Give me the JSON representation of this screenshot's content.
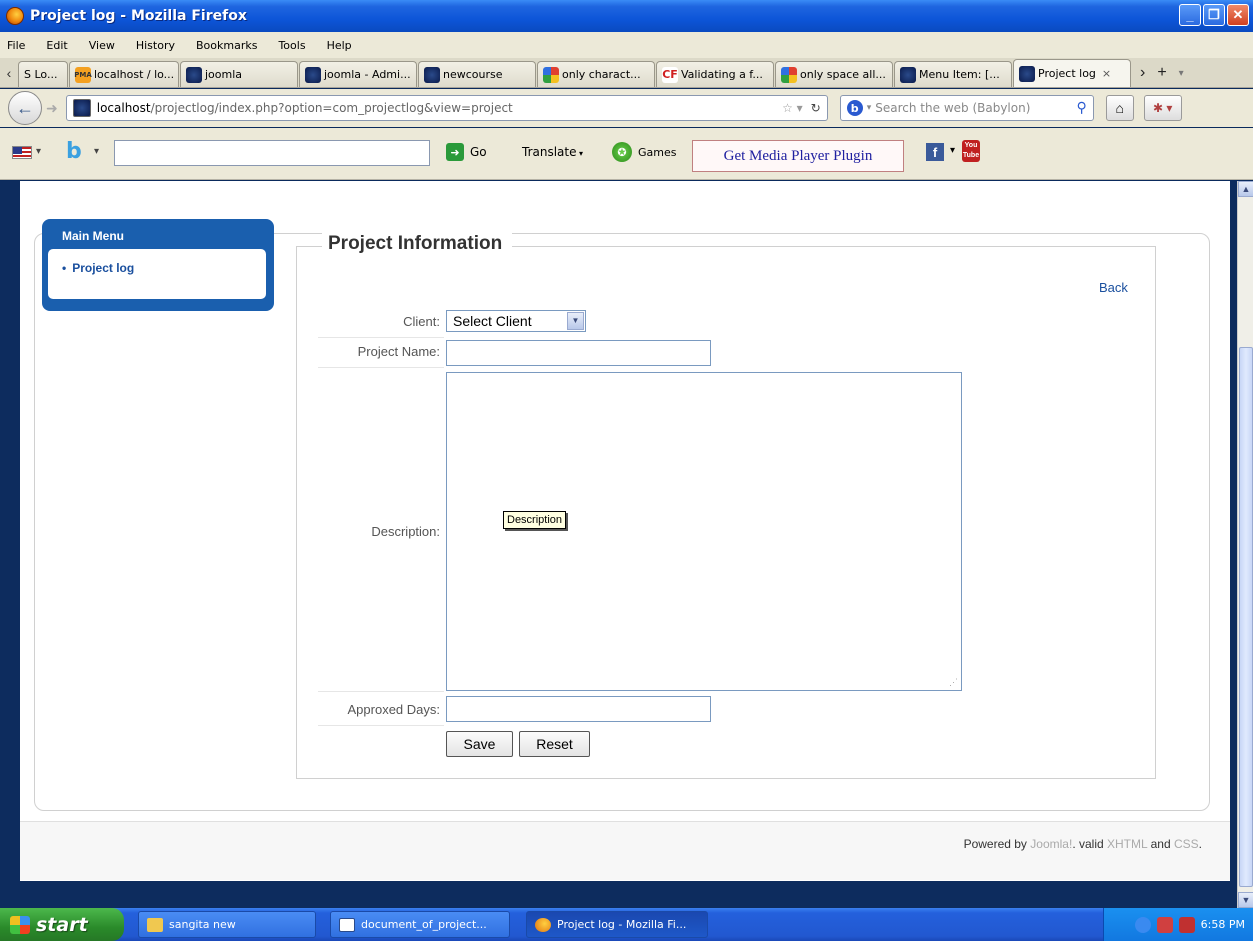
{
  "window": {
    "title": "Project log - Mozilla Firefox"
  },
  "menubar": {
    "items": [
      "File",
      "Edit",
      "View",
      "History",
      "Bookmarks",
      "Tools",
      "Help"
    ]
  },
  "tabs": [
    {
      "label": "S Lo...",
      "icon": "none"
    },
    {
      "label": "localhost / lo...",
      "icon": "phpmyadmin-icon"
    },
    {
      "label": "joomla",
      "icon": "joomla-icon"
    },
    {
      "label": "joomla - Admi...",
      "icon": "joomla-icon"
    },
    {
      "label": "newcourse",
      "icon": "joomla-icon"
    },
    {
      "label": "only charact...",
      "icon": "google-icon"
    },
    {
      "label": "Validating a f...",
      "icon": "coldfusion-icon"
    },
    {
      "label": "only space all...",
      "icon": "google-icon"
    },
    {
      "label": "Menu Item: [...",
      "icon": "joomla-icon"
    },
    {
      "label": "Project log",
      "icon": "joomla-icon",
      "active": true
    }
  ],
  "nav": {
    "url_host": "localhost",
    "url_path": "/projectlog/index.php?option=com_projectlog&view=project",
    "search_placeholder": "Search the web (Babylon)"
  },
  "toolbar2": {
    "go_label": "Go",
    "translate_label": "Translate",
    "games_label": "Games",
    "media_plugin_label": "Get Media Player Plugin",
    "youtube_label": "You Tube"
  },
  "sidebar": {
    "title": "Main Menu",
    "items": [
      {
        "label": "Project log"
      }
    ]
  },
  "form": {
    "legend": "Project Information",
    "back_label": "Back",
    "client_label": "Client:",
    "client_value": "Select Client",
    "project_name_label": "Project Name:",
    "project_name_value": "",
    "description_label": "Description:",
    "description_value": "",
    "description_tooltip": "Description",
    "approxed_days_label": "Approxed Days:",
    "approxed_days_value": "",
    "save_label": "Save",
    "reset_label": "Reset"
  },
  "footer": {
    "prefix": "Powered by",
    "joomla": "Joomla!",
    "mid": ". valid",
    "xhtml": "XHTML",
    "and": "and",
    "css": "CSS",
    "end": "."
  },
  "taskbar": {
    "start_label": "start",
    "tasks": [
      {
        "label": "sangita new",
        "icon": "folder-icon"
      },
      {
        "label": "document_of_project...",
        "icon": "word-icon"
      },
      {
        "label": "Project log - Mozilla Fi...",
        "icon": "firefox-icon",
        "active": true
      }
    ],
    "clock": "6:58 PM"
  },
  "colors": {
    "page_background": "#0d2c5e",
    "menu_blue": "#1a5fae",
    "link_blue": "#1a4f9e"
  }
}
